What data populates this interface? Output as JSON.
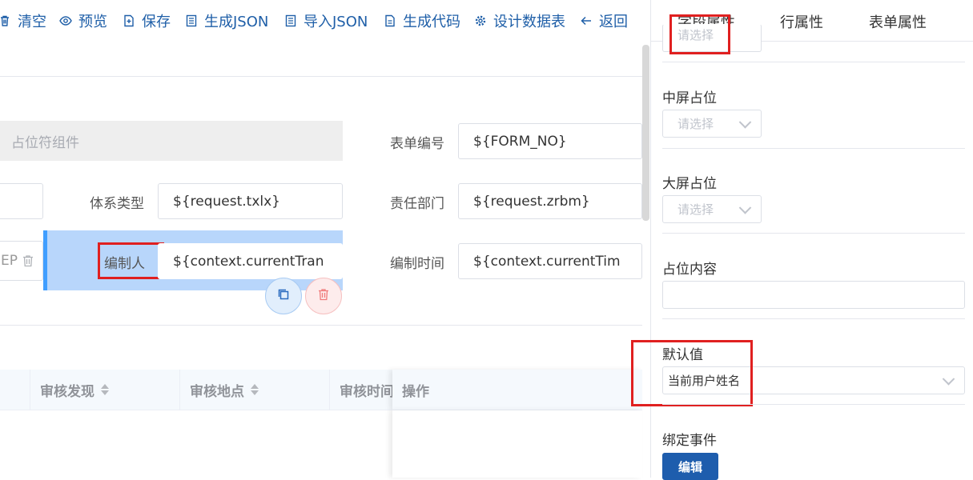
{
  "toolbar": {
    "clear": "清空",
    "preview": "预览",
    "save": "保存",
    "gen_json": "生成JSON",
    "import_json": "导入JSON",
    "gen_code": "生成代码",
    "design_table": "设计数据表",
    "back": "返回"
  },
  "form": {
    "placeholder_component": "占位符组件",
    "form_no_label": "表单编号",
    "form_no_value": "${FORM_NO}",
    "system_type_label": "体系类型",
    "system_type_value": "${request.txlx}",
    "dept_label": "责任部门",
    "dept_value": "${request.zrbm}",
    "truncated_left_value": "EP",
    "author_label": "编制人",
    "author_value": "${context.currentTran",
    "time_label": "编制时间",
    "time_value": "${context.currentTim"
  },
  "table": {
    "columns": [
      {
        "label": "审核发现"
      },
      {
        "label": "审核地点"
      },
      {
        "label": "审核时间"
      }
    ],
    "action_column": "操作"
  },
  "panel": {
    "tabs": [
      "字段属性",
      "行属性",
      "表单属性"
    ],
    "top_select_placeholder": "请选择",
    "medium_label": "中屏占位",
    "medium_placeholder": "请选择",
    "large_label": "大屏占位",
    "large_placeholder": "请选择",
    "content_label": "占位内容",
    "content_value": "",
    "default_label": "默认值",
    "default_value": "当前用户姓名",
    "event_label": "绑定事件",
    "edit_button": "编辑"
  },
  "colors": {
    "accent": "#1f5fa8",
    "selection": "#b8d6fb",
    "selection_bar": "#409eff",
    "highlight_box": "#e02020",
    "edit_button": "#1e5dad"
  }
}
